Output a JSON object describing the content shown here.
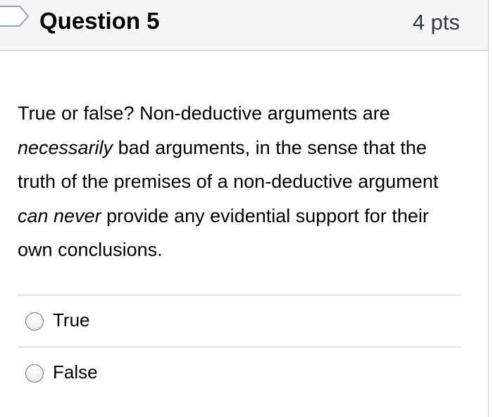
{
  "question": {
    "title": "Question 5",
    "points": "4 pts",
    "text_parts": [
      "True or false? Non-deductive arguments are ",
      "necessarily",
      " bad arguments, in the sense that the truth of the premises of a non-deductive argument ",
      "can never",
      " provide any evidential support for their own conclusions."
    ],
    "flag_icon": "bookmark-flag-icon"
  },
  "answers": [
    {
      "label": "True",
      "selected": false
    },
    {
      "label": "False",
      "selected": false
    }
  ],
  "colors": {
    "header_bg": "#f5f5f5",
    "border": "#c7cdd1",
    "text": "#000000"
  }
}
